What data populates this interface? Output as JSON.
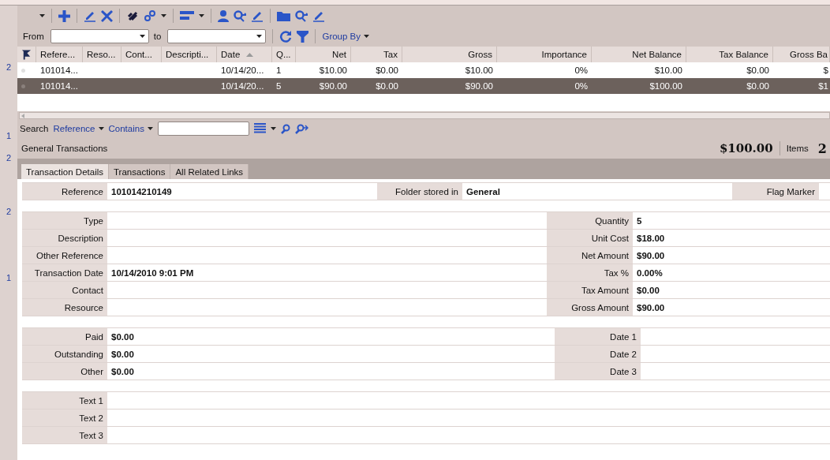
{
  "gutter": [
    "2",
    "1",
    "2",
    "2",
    "1"
  ],
  "filter": {
    "from_label": "From",
    "to_label": "to",
    "group_by": "Group By"
  },
  "grid": {
    "columns": [
      {
        "kind": "flag"
      },
      {
        "label": "Refere...",
        "kind": "text"
      },
      {
        "label": "Reso...",
        "kind": "text"
      },
      {
        "label": "Cont...",
        "kind": "text"
      },
      {
        "label": "Descripti...",
        "kind": "text"
      },
      {
        "label": "Date",
        "kind": "text",
        "sorted": true
      },
      {
        "label": "Q...",
        "kind": "text"
      },
      {
        "label": "Net",
        "kind": "number"
      },
      {
        "label": "Tax",
        "kind": "number"
      },
      {
        "label": "Gross",
        "kind": "number"
      },
      {
        "label": "Importance",
        "kind": "number"
      },
      {
        "label": "Net Balance",
        "kind": "number"
      },
      {
        "label": "Tax Balance",
        "kind": "number"
      },
      {
        "label": "Gross Ba",
        "kind": "number"
      }
    ],
    "rows": [
      {
        "selected": false,
        "cells": [
          null,
          "101014...",
          null,
          null,
          null,
          "10/14/20...",
          "1",
          "$10.00",
          "$0.00",
          "$10.00",
          "0%",
          "$10.00",
          "$0.00",
          "$"
        ]
      },
      {
        "selected": true,
        "cells": [
          null,
          "101014...",
          null,
          null,
          null,
          "10/14/20...",
          "5",
          "$90.00",
          "$0.00",
          "$90.00",
          "0%",
          "$100.00",
          "$0.00",
          "$1"
        ]
      }
    ]
  },
  "search": {
    "label": "Search",
    "field": "Reference",
    "operator": "Contains"
  },
  "title": "General Transactions",
  "summary": {
    "total": "$100.00",
    "items_label": "Items",
    "items": "2"
  },
  "tabs": [
    {
      "label": "Transaction Details",
      "selected": true
    },
    {
      "label": "Transactions",
      "selected": false
    },
    {
      "label": "All Related Links",
      "selected": false
    }
  ],
  "header_fields": [
    {
      "label": "Reference",
      "value": "101014210149"
    },
    {
      "label": "Folder stored in",
      "value": "General"
    },
    {
      "label": "Flag Marker"
    }
  ],
  "details_left": [
    {
      "label": "Type"
    },
    {
      "label": "Description"
    },
    {
      "label": "Other Reference"
    },
    {
      "label": "Transaction Date",
      "value": "10/14/2010 9:01 PM"
    },
    {
      "label": "Contact"
    },
    {
      "label": "Resource"
    }
  ],
  "details_right": [
    {
      "label": "Quantity",
      "value": "5"
    },
    {
      "label": "Unit Cost",
      "value": "$18.00"
    },
    {
      "label": "Net Amount",
      "value": "$90.00"
    },
    {
      "label": "Tax %",
      "value": "0.00%"
    },
    {
      "label": "Tax Amount",
      "value": "$0.00"
    },
    {
      "label": "Gross Amount",
      "value": "$90.00"
    }
  ],
  "payments_left": [
    {
      "label": "Paid",
      "value": "$0.00"
    },
    {
      "label": "Outstanding",
      "value": "$0.00"
    },
    {
      "label": "Other",
      "value": "$0.00"
    }
  ],
  "payments_right": [
    {
      "label": "Date 1"
    },
    {
      "label": "Date 2"
    },
    {
      "label": "Date 3"
    }
  ],
  "texts": [
    {
      "label": "Text 1"
    },
    {
      "label": "Text 2"
    },
    {
      "label": "Text 3"
    }
  ]
}
